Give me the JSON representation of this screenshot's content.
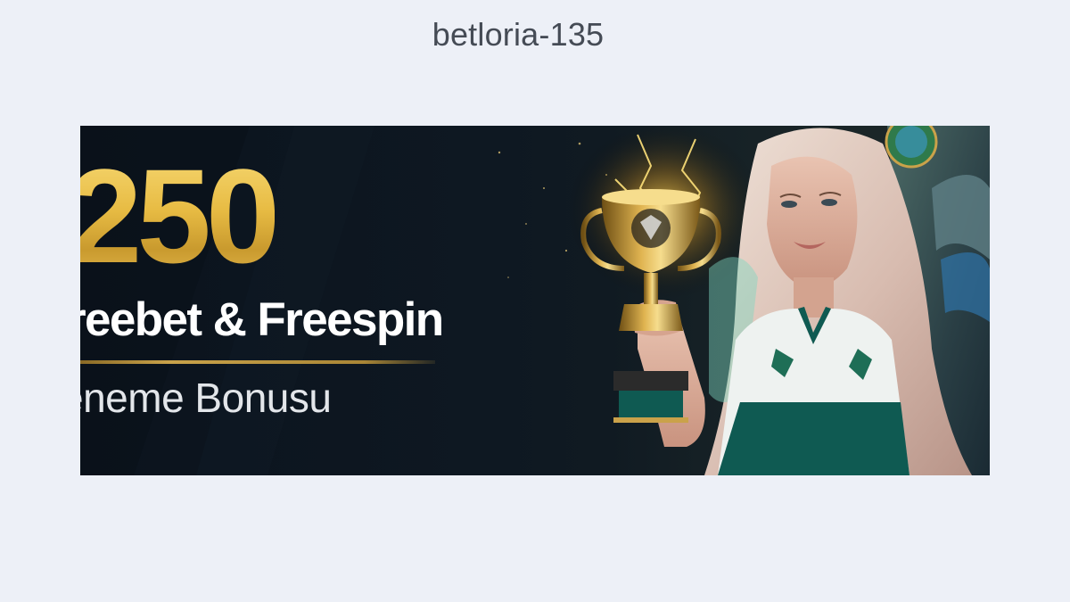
{
  "page": {
    "title": "betloria-135"
  },
  "banner": {
    "amount": "250",
    "offer": "reebet & Freespin",
    "subtitle": "eneme Bonusu",
    "colors": {
      "gold": "#e8bc44",
      "background": "#0e1822",
      "jersey_green": "#0f5a52"
    }
  }
}
